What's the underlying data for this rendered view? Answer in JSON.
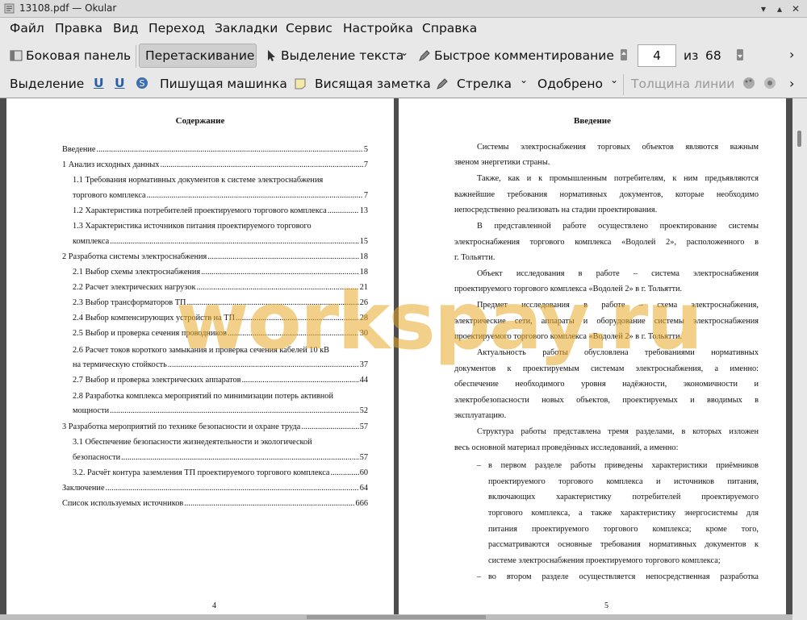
{
  "window": {
    "title": "13108.pdf  — Okular"
  },
  "menu": [
    "Файл",
    "Правка",
    "Вид",
    "Переход",
    "Закладки",
    "Сервис",
    "Настройка",
    "Справка"
  ],
  "toolbar1": {
    "sidebar": "Боковая панель",
    "drag": "Перетаскивание",
    "text_select": "Выделение текста",
    "quick_comment": "Быстрое комментирование",
    "page_current": "4",
    "page_of": "из",
    "page_total": "68"
  },
  "toolbar2": {
    "select": "Выделение",
    "typewriter": "Пишущая машинка",
    "sticky_note": "Висящая заметка",
    "arrow": "Стрелка",
    "approved": "Одобрено",
    "line_width": "Толщина линии"
  },
  "left_page": {
    "title": "Содержание",
    "toc": [
      {
        "text": "Введение",
        "page": "5"
      },
      {
        "text": "1 Анализ исходных данных",
        "page": "7"
      },
      {
        "text": "1.1 Требования нормативных документов к системе электроснабжения",
        "page": ""
      },
      {
        "text": "торгового комплекса",
        "page": "7"
      },
      {
        "text": "1.2 Характеристика потребителей проектируемого торгового комплекса",
        "page": "13"
      },
      {
        "text": "1.3 Характеристика источников питания проектируемого торгового",
        "page": ""
      },
      {
        "text": "комплекса",
        "page": "15"
      },
      {
        "text": "2 Разработка системы электроснабжения",
        "page": "18"
      },
      {
        "text": "2.1 Выбор схемы электроснабжения",
        "page": "18"
      },
      {
        "text": "2.2 Расчет электрических нагрузок",
        "page": "21"
      },
      {
        "text": "2.3 Выбор трансформаторов ТП",
        "page": "26"
      },
      {
        "text": "2.4 Выбор компенсирующих устройств на ТП",
        "page": "28"
      },
      {
        "text": "2.5 Выбор и проверка сечения проводников",
        "page": "30"
      },
      {
        "text": "2.6 Расчет токов короткого замыкания и проверка сечения кабелей 10 кВ",
        "page": ""
      },
      {
        "text": "на термическую стойкость",
        "page": "37"
      },
      {
        "text": "2.7 Выбор и проверка электрических аппаратов",
        "page": "44"
      },
      {
        "text": "2.8 Разработка комплекса мероприятий по минимизации потерь активной",
        "page": ""
      },
      {
        "text": "мощности",
        "page": "52"
      },
      {
        "text": "3 Разработка мероприятий по технике безопасности и охране труда",
        "page": "57"
      },
      {
        "text": "3.1 Обеспечение безопасности жизнедеятельности и экологической",
        "page": ""
      },
      {
        "text": "безопасности",
        "page": "57"
      },
      {
        "text": "3.2. Расчёт контура заземления ТП проектируемого торгового комплекса",
        "page": "60"
      },
      {
        "text": "Заключение",
        "page": "64"
      },
      {
        "text": "Список используемых источников",
        "page": "666"
      }
    ],
    "page_number": "4"
  },
  "right_page": {
    "title": "Введение",
    "lines": [
      "Системы электроснабжения торговых объектов являются важным",
      "звеном энергетики страны.",
      "Также, как и к промышленным потребителям, к ним предъявляются",
      "важнейшие требования нормативных документов, которые необходимо",
      "непосредственно реализовать на стадии проектирования.",
      "В представленной работе осуществлено проектирование системы",
      "электроснабжения торгового комплекса «Водолей 2», расположенного в",
      "г. Тольятти.",
      "Объект исследования в работе – система электроснабжения",
      "проектируемого торгового комплекса «Водолей 2» в г. Тольятти.",
      "Предмет исследования в работе – схема электроснабжения,",
      "электрические сети, аппараты и оборудование системы электроснабжения",
      "проектируемого торгового комплекса «Водолей 2» в г. Тольятти.",
      "Актуальность работы обусловлена требованиями нормативных",
      "документов к проектируемым системам электроснабжения, а именно:",
      "обеспечение необходимого уровня надёжности, экономичности и",
      "электробезопасности новых объектов, проектируемых и вводимых в",
      "эксплуатацию.",
      "Структура работы представлена тремя разделами, в которых изложен",
      "весь основной материал проведённых исследований, а именно:",
      "–",
      "в первом разделе работы приведены характеристики приёмников",
      "проектируемого торгового комплекса и источников питания,",
      "включающих характеристику потребителей проектируемого",
      "торгового комплекса, а также характеристику энергосистемы для",
      "питания проектируемого торгового комплекса; кроме того,",
      "рассматриваются основные требования нормативных документов к",
      "системе электроснабжения проектируемого торгового комплекса;",
      "–",
      "во втором разделе осуществляется непосредственная разработка"
    ],
    "page_number": "5"
  },
  "watermark": "workspay.ru",
  "colors": {
    "watermark": "#e8aa28",
    "viewport_bg": "#4d4d4d",
    "chrome_bg": "#e8e8e8"
  }
}
